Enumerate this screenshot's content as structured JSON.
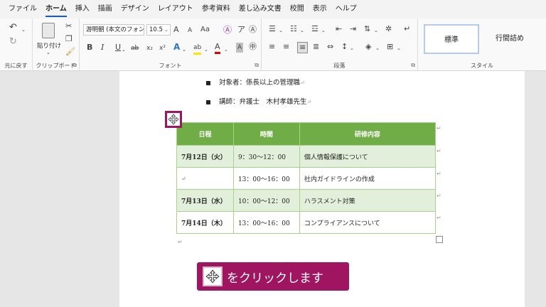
{
  "menu": {
    "tabs": [
      "ファイル",
      "ホーム",
      "挿入",
      "描画",
      "デザイン",
      "レイアウト",
      "参考資料",
      "差し込み文書",
      "校閲",
      "表示",
      "ヘルプ"
    ],
    "active": "ホーム"
  },
  "ribbon": {
    "undo_group_label": "元に戻す",
    "clipboard": {
      "paste_label": "貼り付け",
      "group_label": "クリップボード"
    },
    "font": {
      "font_name": "游明朝 (本文のフォン",
      "font_size": "10.5",
      "grow": "A",
      "shrink": "A",
      "case": "Aa",
      "bold": "B",
      "italic": "I",
      "underline": "U",
      "strike": "ab",
      "subscript": "x₂",
      "superscript": "x²",
      "effects": "A",
      "highlight": "ab",
      "font_color": "A",
      "char_shade": "A",
      "group_label": "フォント"
    },
    "paragraph": {
      "group_label": "段落"
    },
    "styles": {
      "standard": "標準",
      "no_spacing": "行間詰め",
      "group_label": "スタイル"
    }
  },
  "document": {
    "bullets": [
      {
        "text": "対象者：係長以上の管理職"
      },
      {
        "text": "講師：弁護士　木村孝雄先生"
      }
    ],
    "paragraph_mark": "↵",
    "table": {
      "headers": [
        "日程",
        "時間",
        "研修内容"
      ],
      "rows": [
        {
          "date": "7月12日（火）",
          "time": "9：30～12：00",
          "content": "個人情報保護について",
          "shaded": true
        },
        {
          "date": "",
          "time": "13：00～16：00",
          "content": "社内ガイドラインの作成",
          "shaded": false
        },
        {
          "date": "7月13日（水）",
          "time": "10：00～12：00",
          "content": "ハラスメント対策",
          "shaded": true
        },
        {
          "date": "7月14日（木）",
          "time": "13：00～16：00",
          "content": "コンプライアンスについて",
          "shaded": false
        }
      ]
    }
  },
  "callout": {
    "text": "をクリックします"
  },
  "colors": {
    "header_green": "#70ad47",
    "shade_green": "#e2efda",
    "callout": "#a0155f"
  }
}
